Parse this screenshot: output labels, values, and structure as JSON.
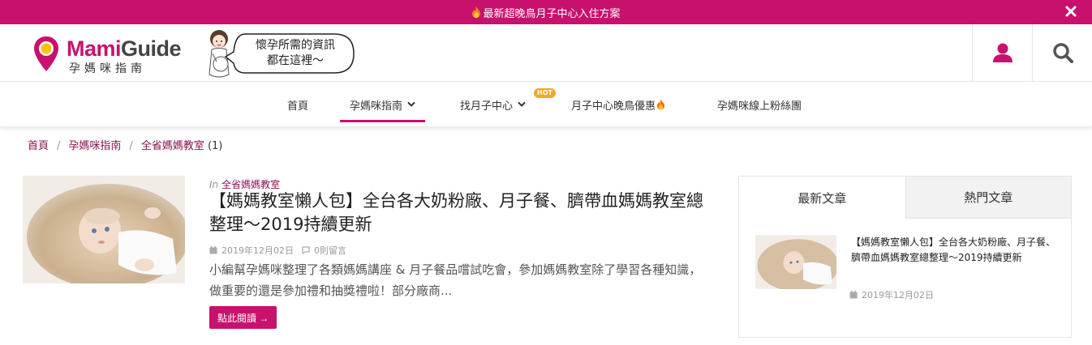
{
  "topbar": {
    "announcement": "最新超晚鳥月子中心入住方案",
    "accent": "#c8116d"
  },
  "logo": {
    "brand_a": "Mami",
    "brand_b": "Guide",
    "subtitle": "孕媽咪指南"
  },
  "bubble": {
    "line1": "懷孕所需的資訊",
    "line2": "都在這裡～"
  },
  "header_icons": [
    "user-icon",
    "search-icon"
  ],
  "nav": {
    "items": [
      {
        "label": "首頁"
      },
      {
        "label": "孕媽咪指南"
      },
      {
        "label": "找月子中心"
      },
      {
        "label": "月子中心晚鳥優惠"
      },
      {
        "label": "孕媽咪線上粉絲團"
      }
    ],
    "hot_badge": "HOT"
  },
  "breadcrumb": {
    "items": [
      "首頁",
      "孕媽咪指南",
      "全省媽媽教室"
    ],
    "count": "(1)"
  },
  "article": {
    "in_label": "In",
    "category": "全省媽媽教室",
    "title": "【媽媽教室懶人包】全台各大奶粉廠、月子餐、臍帶血媽媽教室總整理～2019持續更新",
    "date": "2019年12月02日",
    "comments": "0則留言",
    "excerpt": "小編幫孕媽咪整理了各類媽媽講座 & 月子餐品嚐試吃會，參加媽媽教室除了學習各種知識，做重要的還是參加禮和抽獎禮啦！部分廠商...",
    "read_more": "點此閱讀 →"
  },
  "sidebar": {
    "tabs": [
      "最新文章",
      "熱門文章"
    ],
    "post": {
      "title": "【媽媽教室懶人包】全台各大奶粉廠、月子餐、臍帶血媽媽教室總整理～2019持續更新",
      "date": "2019年12月02日"
    }
  }
}
